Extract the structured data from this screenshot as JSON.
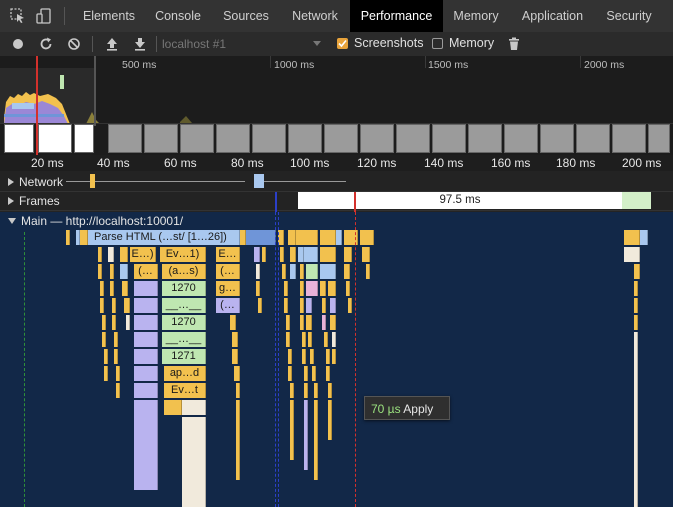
{
  "tabs": [
    {
      "label": "Elements",
      "active": false
    },
    {
      "label": "Console",
      "active": false
    },
    {
      "label": "Sources",
      "active": false
    },
    {
      "label": "Network",
      "active": false
    },
    {
      "label": "Performance",
      "active": true
    },
    {
      "label": "Memory",
      "active": false
    },
    {
      "label": "Application",
      "active": false
    },
    {
      "label": "Security",
      "active": false
    }
  ],
  "toolbar": {
    "profile_select": "localhost #1",
    "screenshots_label": "Screenshots",
    "screenshots_checked": true,
    "memory_label": "Memory",
    "memory_checked": false
  },
  "overview_ruler": [
    "500 ms",
    "1000 ms",
    "1500 ms",
    "2000 ms"
  ],
  "timeline_ruler": [
    "20 ms",
    "40 ms",
    "60 ms",
    "80 ms",
    "100 ms",
    "120 ms",
    "140 ms",
    "160 ms",
    "180 ms",
    "200 ms"
  ],
  "tracks": {
    "network": "Network",
    "frames": "Frames",
    "frame_duration": "97.5 ms",
    "main": "Main — http://localhost:10001/"
  },
  "flame": {
    "parse_html": "Parse HTML (…st/ [1…26])",
    "e1": "E…)",
    "ev1": "Ev…1)",
    "e2": "E…",
    "paren1": "(…",
    "as": "(a…s)",
    "paren2": "(…",
    "n1270a": "1270",
    "g1": "g…",
    "blank1": "__…__",
    "paren3": "(…",
    "n1270b": "1270",
    "dots": "__…__",
    "n1271": "1271",
    "apd": "ap…d",
    "evt": "Ev…t"
  },
  "tooltip": {
    "duration": "70 µs",
    "name": "Apply"
  },
  "colors": {
    "scripting": "#f2c14e",
    "loading": "#a9c8ef",
    "rendering": "#b9b3ef",
    "painting": "#bfe7b1",
    "tooltip_duration": "#9be27f"
  }
}
